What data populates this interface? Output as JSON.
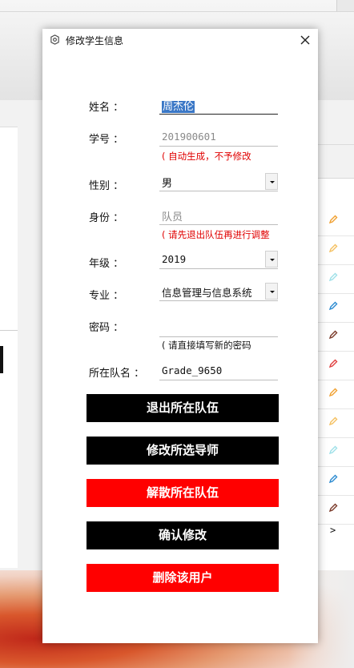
{
  "dialog": {
    "title": "修改学生信息",
    "title_icon": "gear-icon",
    "close_icon": "close-icon"
  },
  "form": {
    "name": {
      "label": "姓名 ：",
      "value": "周杰伦"
    },
    "student_id": {
      "label": "学号 ：",
      "value": "201900601",
      "hint": "( 自动生成，不予修改"
    },
    "gender": {
      "label": "性别 ：",
      "value": "男"
    },
    "identity": {
      "label": "身份 ：",
      "value": "队员",
      "hint": "( 请先退出队伍再进行调整"
    },
    "grade": {
      "label": "年级 ：",
      "value": "2019"
    },
    "major": {
      "label": "专业 ：",
      "value": "信息管理与信息系统"
    },
    "password": {
      "label": "密码 ：",
      "value": "",
      "hint": "( 请直接填写新的密码"
    },
    "team": {
      "label": "所在队名 ：",
      "value": "Grade_9650"
    }
  },
  "buttons": {
    "leave_team": "退出所在队伍",
    "change_mentor": "修改所选导师",
    "dissolve_team": "解散所在队伍",
    "confirm": "确认修改",
    "delete_user": "删除该用户"
  },
  "colors": {
    "accent_black": "#000000",
    "danger_red": "#ff0000",
    "hint_red": "#e00000",
    "selection_blue": "#3a77c6"
  },
  "background": {
    "edit_icon": "pencil-icon",
    "next_label": ">"
  }
}
